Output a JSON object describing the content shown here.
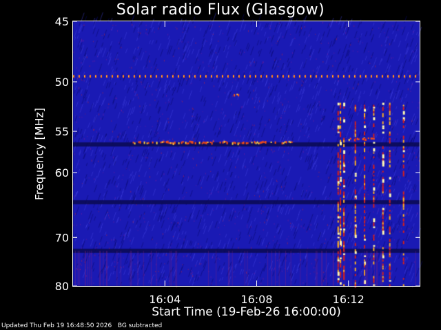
{
  "chart_data": {
    "type": "heatmap",
    "title": "Solar radio Flux (Glasgow)",
    "xlabel": "Start Time (19-Feb-26 16:00:00)",
    "ylabel": "Frequency [MHz]",
    "x_unit": "minutes after 16:00:00",
    "xlim": [
      0,
      15.1
    ],
    "ylim": [
      45,
      80
    ],
    "y_inverted": true,
    "x_ticks": [
      {
        "value": 4,
        "label": "16:04"
      },
      {
        "value": 8,
        "label": "16:08"
      },
      {
        "value": 12,
        "label": "16:12"
      }
    ],
    "y_ticks": [
      {
        "value": 45,
        "label": "45"
      },
      {
        "value": 50,
        "label": "50"
      },
      {
        "value": 55,
        "label": "55"
      },
      {
        "value": 60,
        "label": "60"
      },
      {
        "value": 70,
        "label": "70"
      },
      {
        "value": 80,
        "label": "80"
      }
    ],
    "colormap": [
      "#140a7a",
      "#2222c8",
      "#6a1fa0",
      "#d01818",
      "#ff7a10",
      "#ffe040"
    ],
    "background_color": "#1a1ab4",
    "features": [
      {
        "kind": "horizontal_line",
        "freq_mhz": 49.5,
        "x_range": [
          0,
          15.1
        ],
        "color": "#ff6a10"
      },
      {
        "kind": "dark_band",
        "freq_mhz": 56.5
      },
      {
        "kind": "dark_band",
        "freq_mhz": 64.2
      },
      {
        "kind": "dark_band",
        "freq_mhz": 72.5
      },
      {
        "kind": "burst_patch",
        "freq_mhz": 56.2,
        "x_range": [
          2.6,
          9.6
        ],
        "color": "#ff5010"
      },
      {
        "kind": "burst_patch",
        "freq_mhz": 51.1,
        "x_range": [
          7.0,
          7.2
        ],
        "color": "#ff5010"
      },
      {
        "kind": "burst_patch",
        "freq_mhz": 55.8,
        "x_range": [
          12.0,
          13.1
        ],
        "color": "#ff5010"
      },
      {
        "kind": "vertical_burst_lines",
        "x_values": [
          11.55,
          11.65,
          11.8,
          12.3,
          12.7,
          13.1,
          13.5,
          13.8,
          14.4
        ],
        "freq_range": [
          52,
          80
        ],
        "color": "#ff8a20"
      }
    ]
  },
  "footer": {
    "updated": "Updated Thu Feb 19 16:48:50 2026",
    "note": "BG subtracted"
  }
}
